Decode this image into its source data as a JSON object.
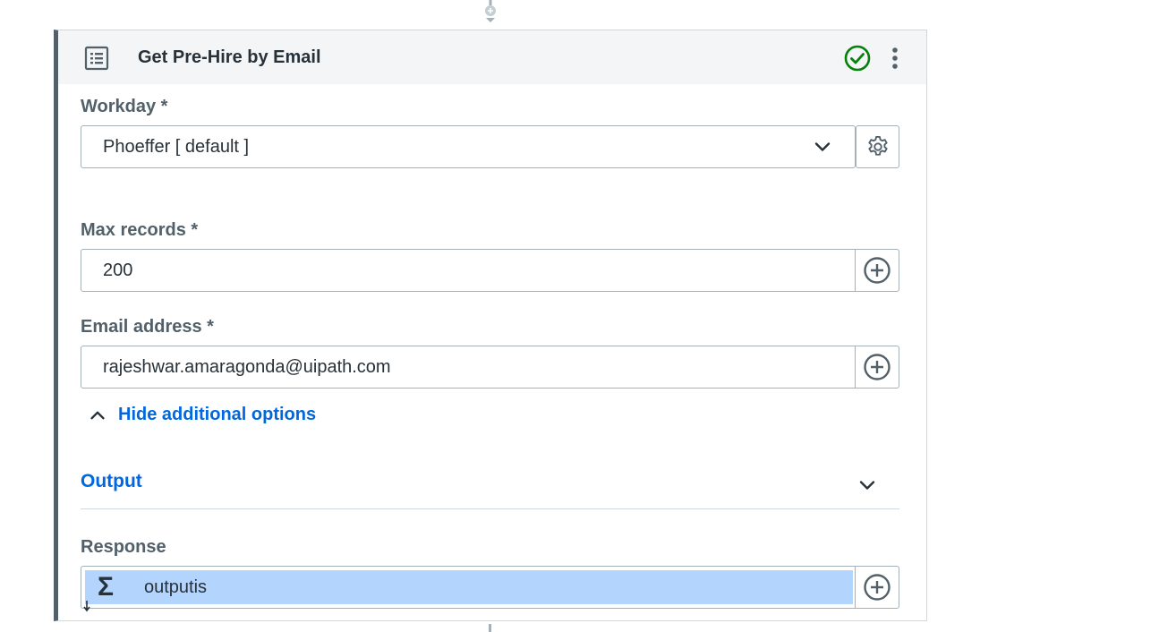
{
  "activity": {
    "title": "Get Pre-Hire by Email",
    "icon": "list-document-icon",
    "status_icon": "check-circle-icon",
    "status_color": "#038108",
    "menu_icon": "more-vertical-icon"
  },
  "fields": {
    "workday": {
      "label": "Workday *",
      "value": "Phoeffer [ default ]",
      "icon": "gear-icon"
    },
    "max_records": {
      "label": "Max records *",
      "value": "200",
      "icon": "plus-circle-icon"
    },
    "email": {
      "label": "Email address *",
      "value": "rajeshwar.amaragonda@uipath.com",
      "icon": "plus-circle-icon"
    }
  },
  "options_toggle": {
    "label": "Hide additional options"
  },
  "output_section": {
    "title": "Output"
  },
  "response": {
    "label": "Response",
    "symbol": "Σ",
    "value": "outputis"
  },
  "colors": {
    "accent": "#0067df",
    "selection": "#b3d4fc",
    "border": "#a4b1b8"
  }
}
